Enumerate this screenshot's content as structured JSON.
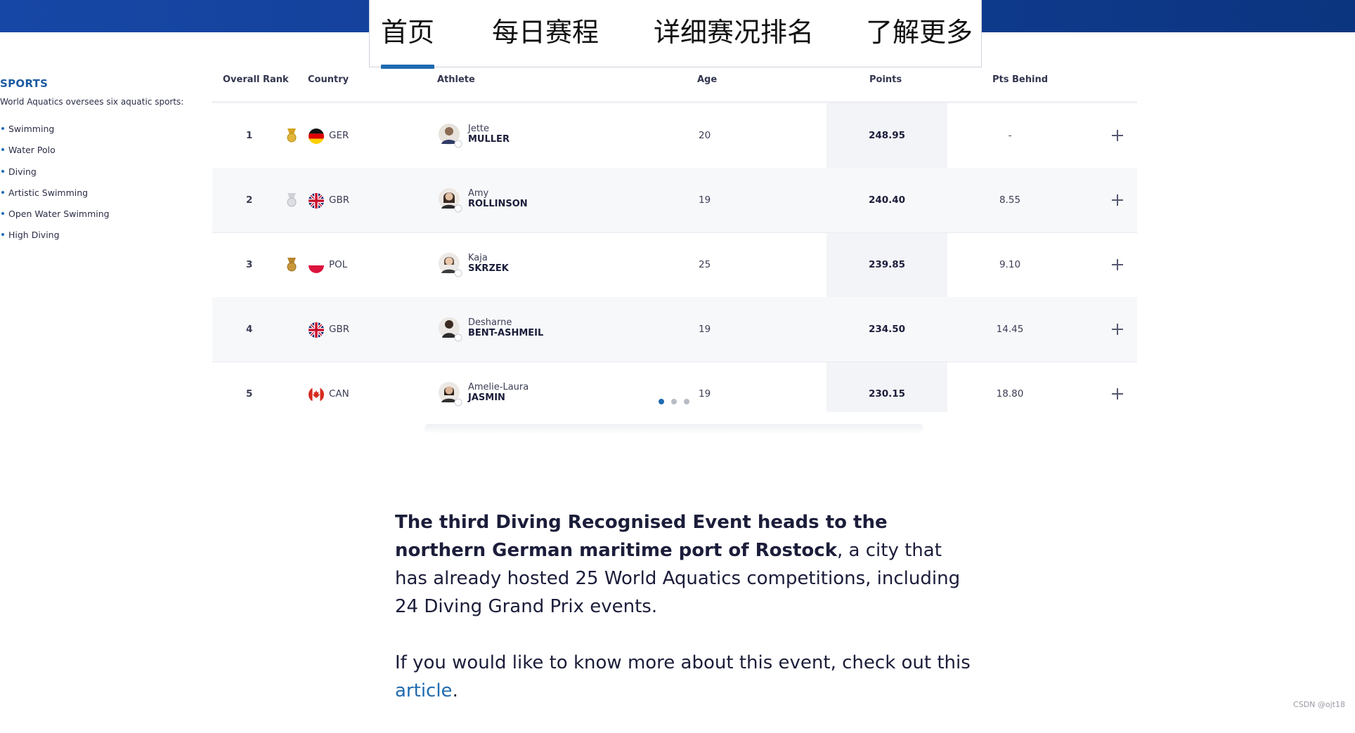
{
  "nav": {
    "tabs": [
      {
        "label": "首页",
        "active": true
      },
      {
        "label": "每日赛程",
        "active": false
      },
      {
        "label": "详细赛况排名",
        "active": false
      },
      {
        "label": "了解更多",
        "active": false
      }
    ]
  },
  "sidebar": {
    "heading": "SPORTS",
    "description": "World Aquatics oversees six aquatic sports:",
    "items": [
      "Swimming",
      "Water Polo",
      "Diving",
      "Artistic Swimming",
      "Open Water Swimming",
      "High Diving"
    ]
  },
  "table": {
    "headers": {
      "rank": "Overall Rank",
      "country": "Country",
      "athlete": "Athlete",
      "age": "Age",
      "points": "Points",
      "behind": "Pts Behind"
    },
    "rows": [
      {
        "rank": "1",
        "medal": "gold",
        "country": "GER",
        "first": "Jette",
        "last": "MULLER",
        "age": "20",
        "points": "248.95",
        "behind": "-"
      },
      {
        "rank": "2",
        "medal": "silver",
        "country": "GBR",
        "first": "Amy",
        "last": "ROLLINSON",
        "age": "19",
        "points": "240.40",
        "behind": "8.55"
      },
      {
        "rank": "3",
        "medal": "bronze",
        "country": "POL",
        "first": "Kaja",
        "last": "SKRZEK",
        "age": "25",
        "points": "239.85",
        "behind": "9.10"
      },
      {
        "rank": "4",
        "medal": "",
        "country": "GBR",
        "first": "Desharne",
        "last": "BENT-ASHMEIL",
        "age": "19",
        "points": "234.50",
        "behind": "14.45"
      },
      {
        "rank": "5",
        "medal": "",
        "country": "CAN",
        "first": "Amelie-Laura",
        "last": "JASMIN",
        "age": "19",
        "points": "230.15",
        "behind": "18.80"
      }
    ],
    "carousel_active_index": 0,
    "carousel_count": 3
  },
  "article": {
    "p1_bold": "The third Diving Recognised Event heads to the northern German maritime port of Rostock",
    "p1_rest": ", a city that has already hosted 25 World Aquatics competitions, including 24 Diving Grand Prix events.",
    "p2_text": "If you would like to know more about this event, check out this ",
    "p2_link": "article",
    "p2_end": "."
  },
  "watermark": "CSDN @ojt18",
  "colors": {
    "brand_blue": "#1747a6",
    "link_blue": "#1f6bb0",
    "gold": "#d4a520",
    "silver": "#c7c9cf",
    "bronze": "#b8862d"
  }
}
